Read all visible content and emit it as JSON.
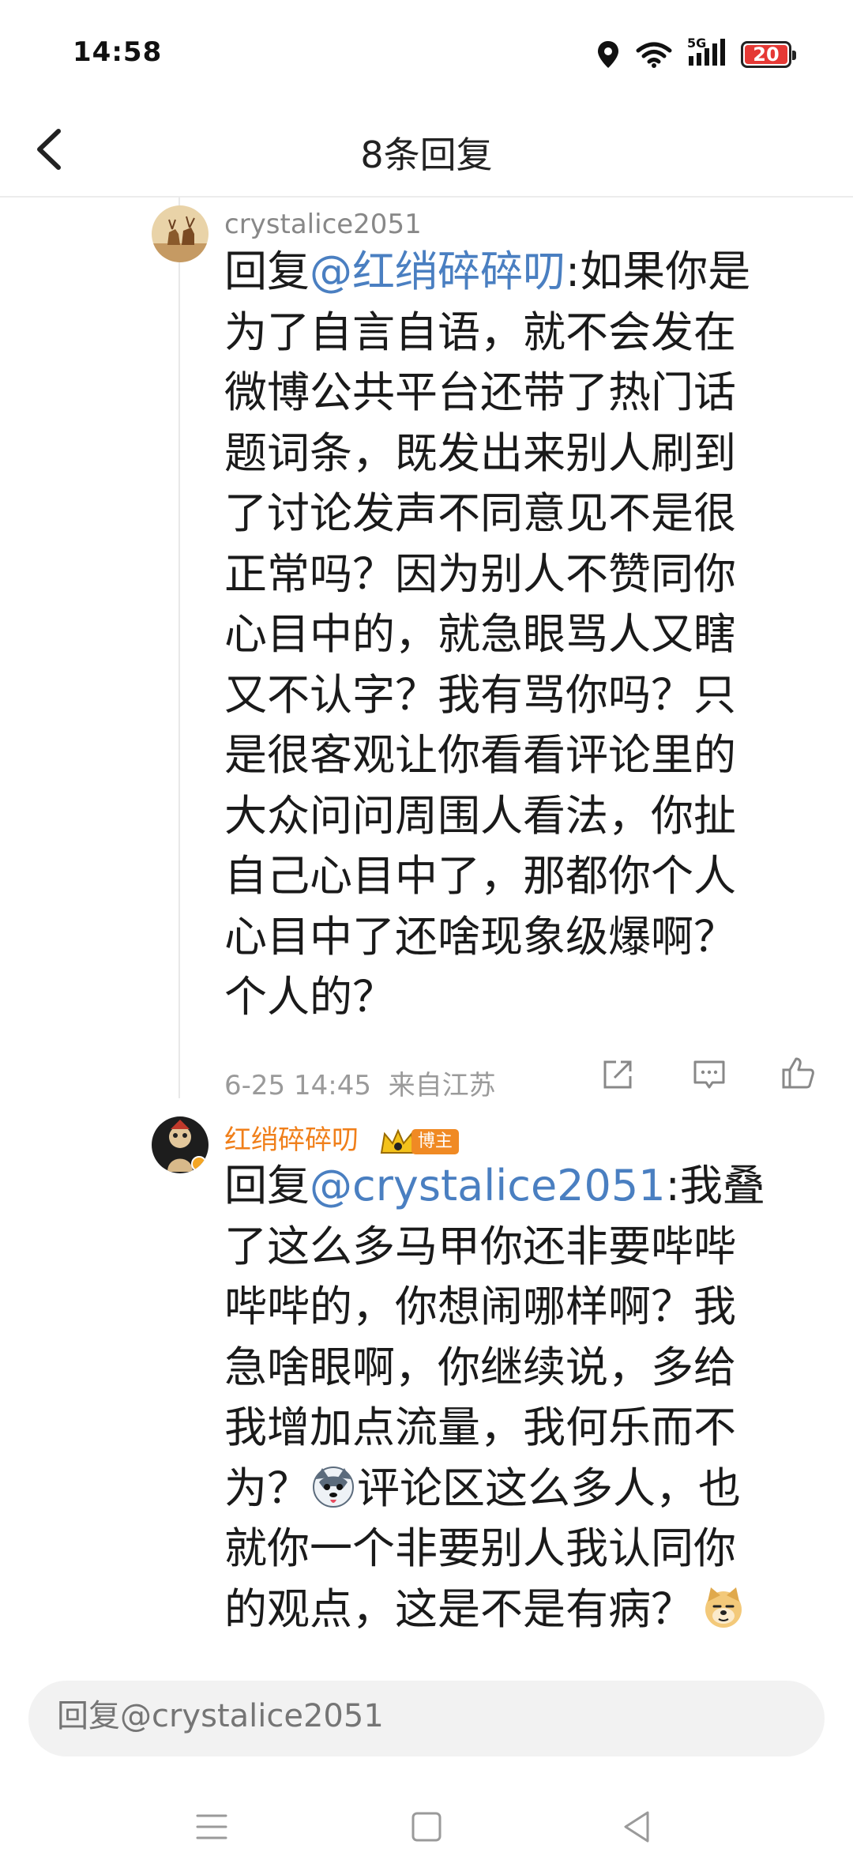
{
  "status": {
    "time": "14:58",
    "network": "5G",
    "battery": "20",
    "battery_level": 0.2,
    "icons": [
      "location-icon",
      "wifi-icon",
      "signal-icon",
      "battery-icon"
    ]
  },
  "header": {
    "title": "8条回复",
    "back_icon": "chevron-left-icon"
  },
  "comments": [
    {
      "username": "crystalice2051",
      "username_color": "#888888",
      "reply_prefix": "回复",
      "mention": "@红绡碎碎叨",
      "text_lines": [
        ":如果你是",
        "为了自言自语，就不会发在",
        "微博公共平台还带了热门话",
        "题词条，既发出来别人刷到",
        "了讨论发声不同意见不是很",
        "正常吗？因为别人不赞同你",
        "心目中的，就急眼骂人又瞎",
        "又不认字？我有骂你吗？只",
        "是很客观让你看看评论里的",
        "大众问问周围人看法，你扯",
        "自己心目中了，那都你个人",
        "心目中了还啥现象级爆啊？",
        "个人的？"
      ],
      "meta": "6-25 14:45  来自江苏",
      "actions": [
        "share-icon",
        "comment-icon",
        "like-icon"
      ]
    },
    {
      "username": "红绡碎碎叨",
      "username_color": "#f07f1a",
      "badge": "博主",
      "reply_prefix": "回复",
      "mention": "@crystalice2051",
      "text_lines": [
        ":我叠",
        "了这么多马甲你还非要哔哔",
        "哔哔的，你想闹哪样啊？我",
        "急啥眼啊，你继续说，多给",
        "我增加点流量，我何乐而不",
        "评论区这么多人，也",
        "就你一个非要别人我认同你",
        "的观点，这是不是有病？"
      ],
      "line5_prefix": "为？"
    }
  ],
  "reply_bar": {
    "placeholder": "回复@crystalice2051"
  },
  "nav": {
    "items": [
      "menu-icon",
      "home-icon",
      "back-icon"
    ]
  },
  "colors": {
    "mention": "#4a7fc1",
    "blogger_badge": "#f08a24",
    "meta": "#9a9a9a"
  }
}
